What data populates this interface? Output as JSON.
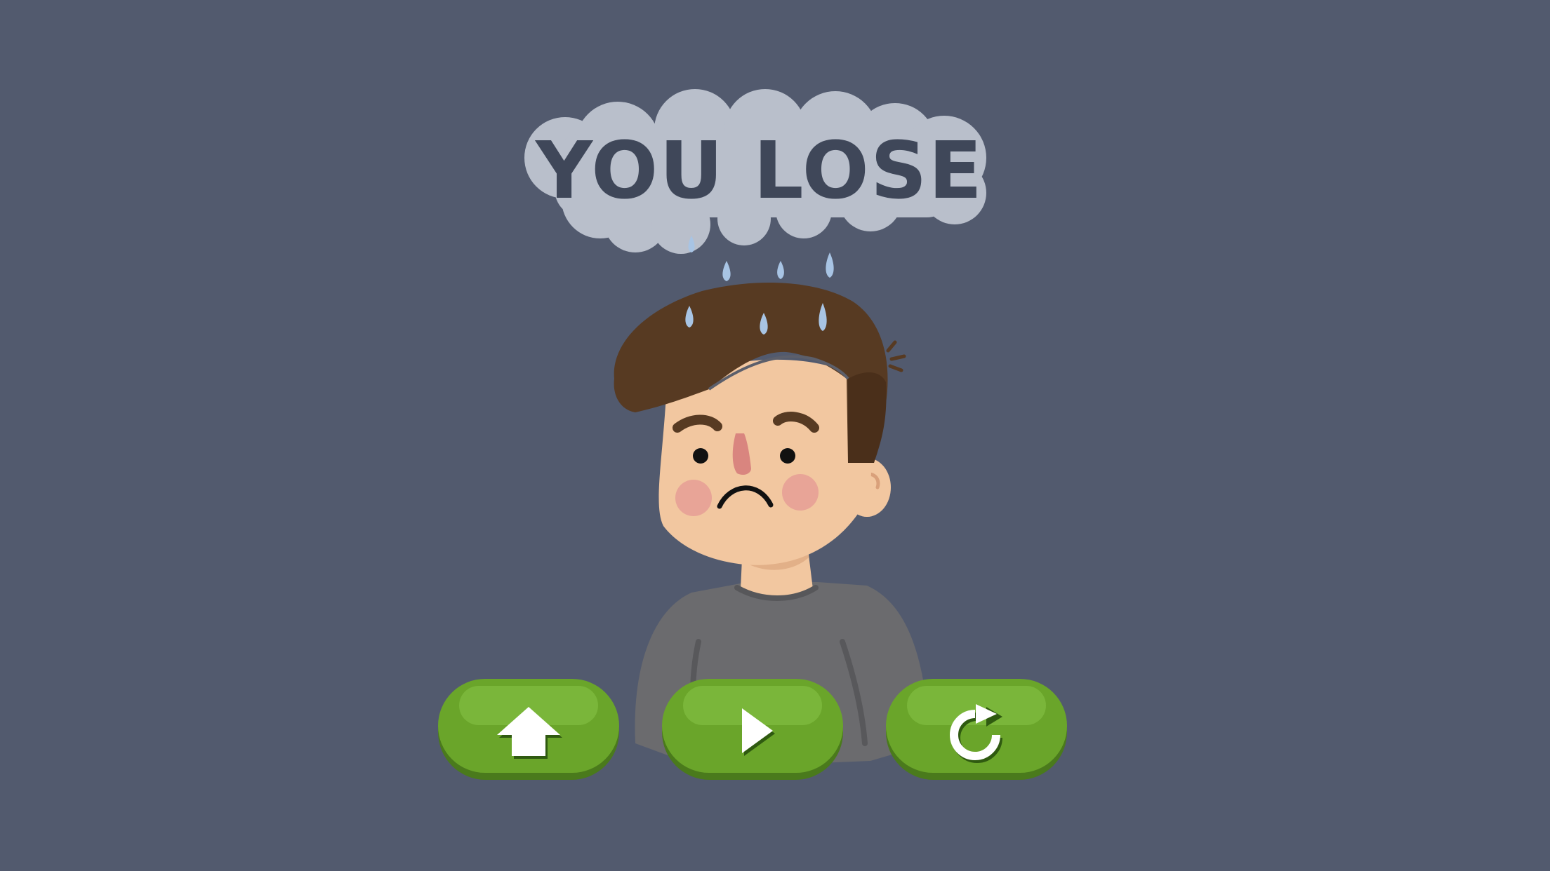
{
  "screen": {
    "background_color": "#525a6e",
    "title": "YOU LOSE",
    "title_color": "#3f4759",
    "cloud_color": "#b9bfcb",
    "raindrop_color": "#a8c4e4"
  },
  "character": {
    "hair_color": "#573a22",
    "skin_color": "#f2c7a0",
    "cheek_color": "#e8a497",
    "nose_color": "#d9857f",
    "shirt_color": "#6b6b6e",
    "expression": "sad"
  },
  "buttons": [
    {
      "name": "home-button",
      "icon": "home-arrow-up-icon",
      "action": "home"
    },
    {
      "name": "play-button",
      "icon": "play-icon",
      "action": "continue"
    },
    {
      "name": "restart-button",
      "icon": "restart-icon",
      "action": "retry"
    }
  ],
  "button_color": "#6aa52a",
  "button_shadow_color": "#4a7a1c"
}
